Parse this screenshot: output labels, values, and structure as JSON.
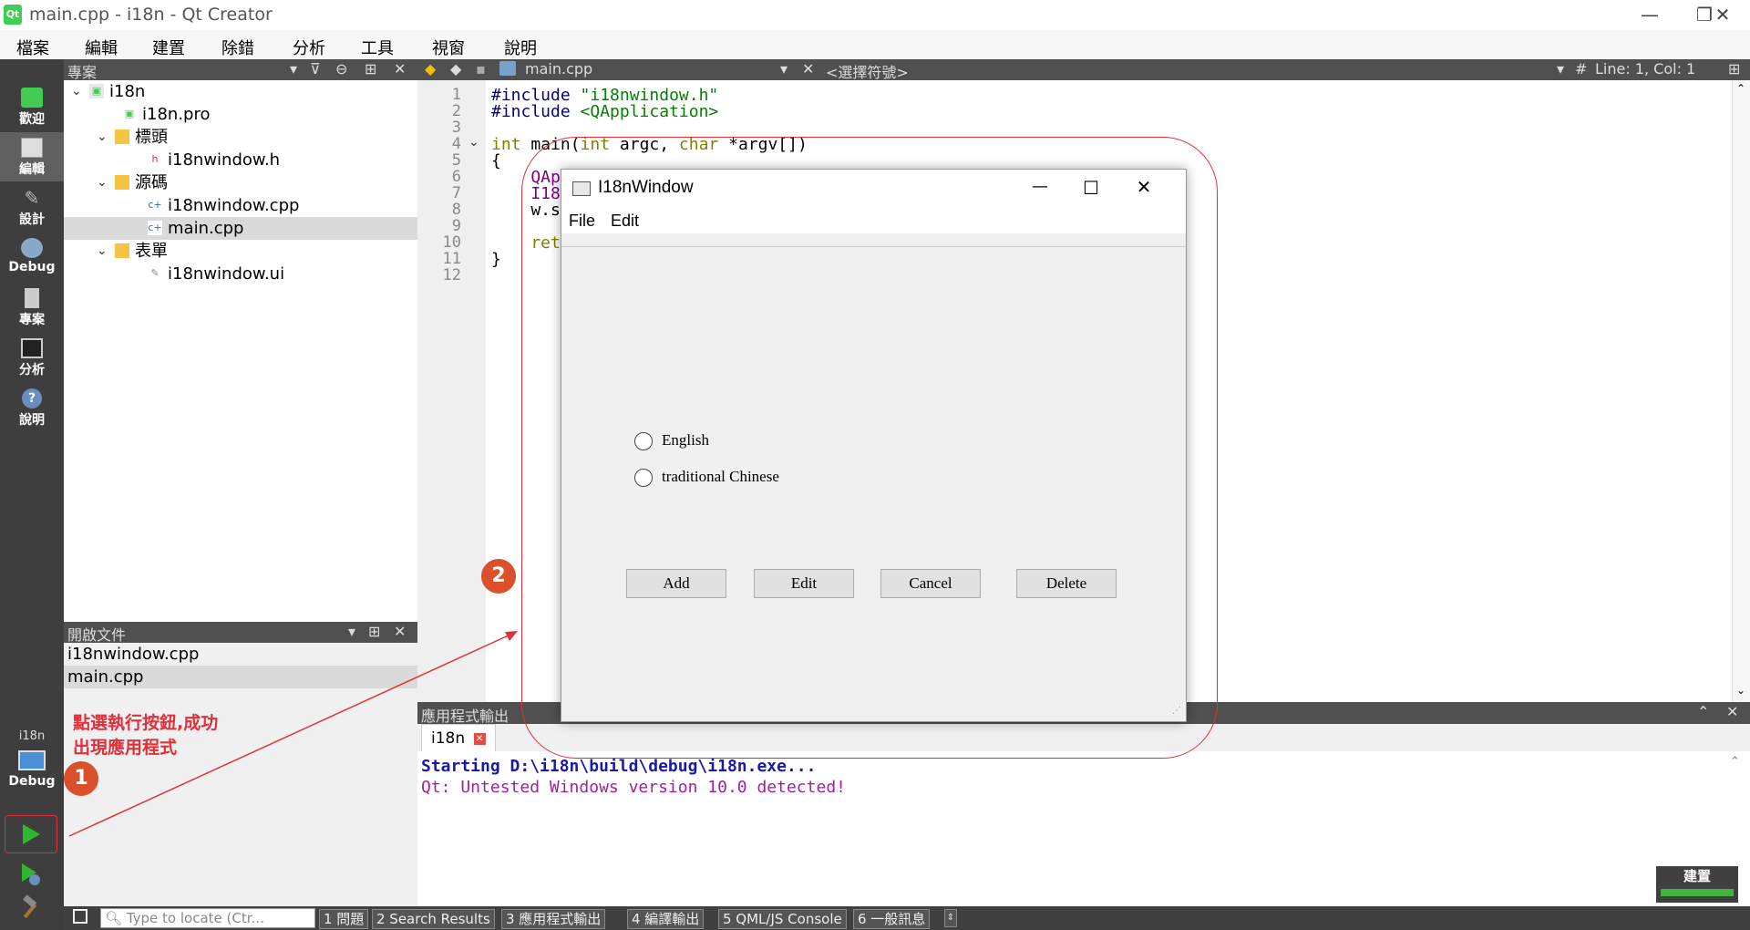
{
  "window": {
    "title": "main.cpp - i18n - Qt Creator",
    "logo": "Qt"
  },
  "menubar": [
    "檔案",
    "編輯",
    "建置",
    "除錯",
    "分析",
    "工具",
    "視窗",
    "說明"
  ],
  "modes": [
    {
      "label": "歡迎",
      "icon": "qt-welcome-icon"
    },
    {
      "label": "編輯",
      "icon": "edit-mode-icon"
    },
    {
      "label": "設計",
      "icon": "design-icon"
    },
    {
      "label": "Debug",
      "icon": "debug-icon"
    },
    {
      "label": "專案",
      "icon": "projects-icon"
    },
    {
      "label": "分析",
      "icon": "analyze-icon"
    },
    {
      "label": "說明",
      "icon": "help-icon"
    }
  ],
  "kit": {
    "project": "i18n",
    "config": "Debug"
  },
  "project_panel": {
    "title": "專案",
    "tree": [
      {
        "label": "i18n",
        "level": 0,
        "caret": "v"
      },
      {
        "label": "i18n.pro",
        "level": 1,
        "caret": ""
      },
      {
        "label": "標頭",
        "level": 1,
        "caret": "v"
      },
      {
        "label": "i18nwindow.h",
        "level": 2,
        "caret": ""
      },
      {
        "label": "源碼",
        "level": 1,
        "caret": "v"
      },
      {
        "label": "i18nwindow.cpp",
        "level": 2,
        "caret": ""
      },
      {
        "label": "main.cpp",
        "level": 2,
        "caret": "",
        "selected": true
      },
      {
        "label": "表單",
        "level": 1,
        "caret": "v"
      },
      {
        "label": "i18nwindow.ui",
        "level": 2,
        "caret": ""
      }
    ]
  },
  "open_docs": {
    "title": "開啟文件",
    "items": [
      "i18nwindow.cpp",
      "main.cpp"
    ]
  },
  "editor": {
    "file": "main.cpp",
    "symbol": "<選擇符號>",
    "position": "Line: 1, Col: 1",
    "hash": "#",
    "lines": [
      "#include \"i18nwindow.h\"",
      "#include <QApplication>",
      "",
      "int main(int argc, char *argv[])",
      "{",
      "    QAp",
      "    I18",
      "    w.s",
      "",
      "    ret",
      "}",
      ""
    ],
    "line_numbers": [
      "1",
      "2",
      "3",
      "4",
      "5",
      "6",
      "7",
      "8",
      "9",
      "10",
      "11",
      "12"
    ]
  },
  "output": {
    "title": "應用程式輸出",
    "tab": "i18n",
    "lines": [
      {
        "text": "Starting D:\\i18n\\build\\debug\\i18n.exe...",
        "color": "#1a1aa6"
      },
      {
        "text": "Qt: Untested Windows version 10.0 detected!",
        "color": "#a020a0"
      }
    ]
  },
  "statusbar": {
    "locator_placeholder": "Type to locate (Ctr...",
    "tabs": [
      "1 問題",
      "2 Search Results",
      "3 應用程式輸出",
      "4 編譯輸出",
      "5 QML/JS Console",
      "6 一般訊息"
    ]
  },
  "build_indicator": {
    "label": "建置"
  },
  "app": {
    "title": "I18nWindow",
    "menu": [
      "File",
      "Edit"
    ],
    "radios": [
      "English",
      "traditional Chinese"
    ],
    "buttons": [
      "Add",
      "Edit",
      "Cancel",
      "Delete"
    ]
  },
  "annotations": {
    "note": [
      "點選執行按鈕,成功",
      "出現應用程式"
    ],
    "badge1": "1",
    "badge2": "2",
    "color": "#e0303a"
  }
}
